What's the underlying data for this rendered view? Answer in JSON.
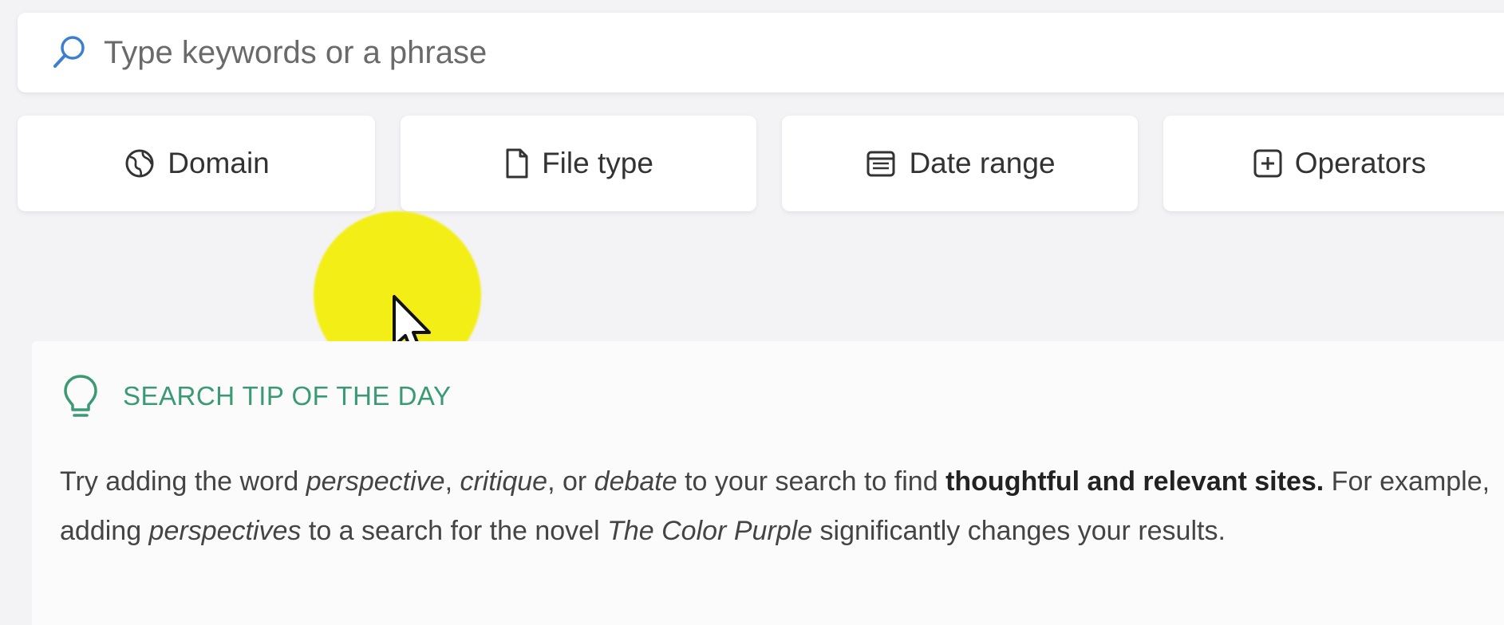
{
  "search": {
    "placeholder": "Type keywords or a phrase"
  },
  "filters": {
    "domain_label": "Domain",
    "filetype_label": "File type",
    "daterange_label": "Date range",
    "operators_label": "Operators"
  },
  "tip": {
    "title": "SEARCH TIP OF THE DAY",
    "parts": {
      "p1": "Try adding the word ",
      "w1": "perspective",
      "p2": ", ",
      "w2": "critique",
      "p3": ", or ",
      "w3": "debate",
      "p4": " to your search to find ",
      "b1": "thoughtful and relevant sites.",
      "p5": " For example, adding ",
      "w4": "perspectives",
      "p6": " to a search for the novel ",
      "w5": "The Color Purple",
      "p7": " significantly changes your results."
    }
  },
  "colors": {
    "accent_green": "#3a9a74",
    "search_icon_blue": "#3b7fd4",
    "cursor_highlight": "#f4ee0a"
  },
  "icons": {
    "search": "search-icon",
    "domain": "globe-icon",
    "filetype": "document-icon",
    "daterange": "calendar-icon",
    "operators": "plus-box-icon",
    "tip": "lightbulb-icon",
    "cursor": "cursor-arrow-icon"
  }
}
